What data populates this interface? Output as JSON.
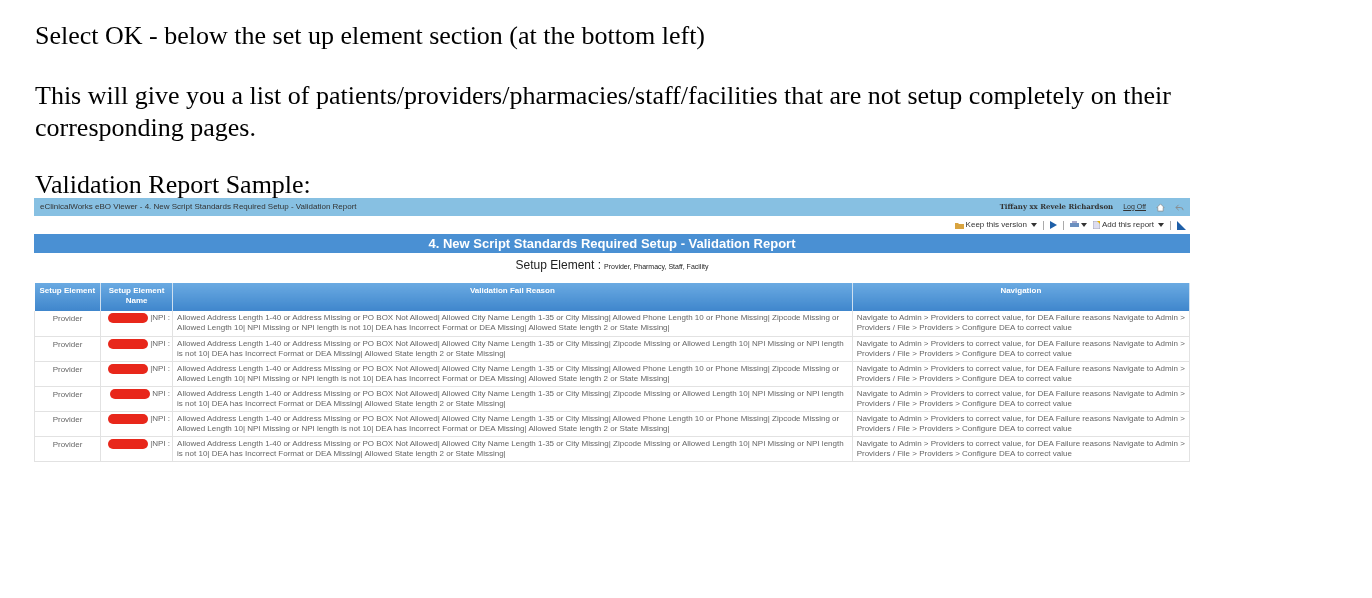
{
  "paragraphs": [
    "Select OK - below the set up element section (at the bottom left)",
    "This will give you a list of patients/providers/pharmacies/staff/facilities that are not setup completely on their corresponding pages.",
    "Validation Report Sample:"
  ],
  "viewer": {
    "title": "eClinicalWorks eBO Viewer - 4. New Script Standards Required Setup - Validation Report",
    "user": "Tiffany xx Revele Richardson",
    "logoff": "Log Off",
    "toolbar": [
      "Keep this version",
      "Add this report"
    ],
    "report_title": "4. New Script Standards Required Setup - Validation Report",
    "subtitle_label": "Setup Element :",
    "subtitle_value": "Provider, Pharmacy, Staff, Facility",
    "columns": [
      "Setup Element",
      "Setup Element Name",
      "Validation Fail Reason",
      "Navigation"
    ],
    "rows": [
      {
        "element": "Provider",
        "name": "|NPI :",
        "reason": "Allowed Address Length 1-40 or Address Missing or PO BOX Not Allowed| Allowed City Name Length 1-35 or City Missing| Allowed Phone Length 10 or Phone Missing| Zipcode Missing or Allowed Length 10| NPI Missing or NPI length is not 10| DEA has Incorrect Format or DEA Missing|  Allowed State length 2 or State Missing|",
        "navigation": "Navigate to Admin > Providers to correct value, for DEA Failure reasons Navigate to Admin > Providers / File > Providers > Configure DEA to correct value"
      },
      {
        "element": "Provider",
        "name": "|NPI :",
        "reason": "Allowed Address Length 1-40 or Address Missing or PO BOX Not Allowed| Allowed City Name Length 1-35 or City Missing| Zipcode Missing or Allowed Length 10| NPI Missing or NPI length is not 10| DEA has Incorrect Format or DEA Missing|  Allowed State length 2 or State Missing|",
        "navigation": "Navigate to Admin > Providers to correct value, for DEA Failure reasons Navigate to Admin > Providers / File > Providers > Configure DEA to correct value"
      },
      {
        "element": "Provider",
        "name": "|NPI :",
        "reason": "Allowed Address Length 1-40 or Address Missing or PO BOX Not Allowed| Allowed City Name Length 1-35 or City Missing| Allowed Phone Length 10 or Phone Missing| Zipcode Missing or Allowed Length 10| NPI Missing or NPI length is not 10| DEA has Incorrect Format or DEA Missing|  Allowed State length 2 or State Missing|",
        "navigation": "Navigate to Admin > Providers to correct value, for DEA Failure reasons Navigate to Admin > Providers / File > Providers > Configure DEA to correct value"
      },
      {
        "element": "Provider",
        "name": "NPI :",
        "reason": "Allowed Address Length 1-40 or Address Missing or PO BOX Not Allowed| Allowed City Name Length 1-35 or City Missing| Zipcode Missing or Allowed Length 10| NPI Missing or NPI length is not 10| DEA has Incorrect Format or DEA Missing|  Allowed State length 2 or State Missing|",
        "navigation": "Navigate to Admin > Providers to correct value, for DEA Failure reasons Navigate to Admin > Providers / File > Providers > Configure DEA to correct value"
      },
      {
        "element": "Provider",
        "name": "|NPI :",
        "reason": "Allowed Address Length 1-40 or Address Missing or PO BOX Not Allowed| Allowed City Name Length 1-35 or City Missing| Allowed Phone Length 10 or Phone Missing| Zipcode Missing or Allowed Length 10| NPI Missing or NPI length is not 10| DEA has Incorrect Format or DEA Missing|  Allowed State length 2 or State Missing|",
        "navigation": "Navigate to Admin > Providers to correct value, for DEA Failure reasons Navigate to Admin > Providers / File > Providers > Configure DEA to correct value"
      },
      {
        "element": "Provider",
        "name": "|NPI :",
        "reason": "Allowed Address Length 1-40 or Address Missing or PO BOX Not Allowed| Allowed City Name Length 1-35 or City Missing| Zipcode Missing or Allowed Length 10| NPI Missing or NPI length is not 10| DEA has Incorrect Format or DEA Missing|  Allowed State length 2 or State Missing|",
        "navigation": "Navigate to Admin > Providers to correct value, for DEA Failure reasons Navigate to Admin > Providers / File > Providers > Configure DEA to correct value"
      }
    ]
  }
}
